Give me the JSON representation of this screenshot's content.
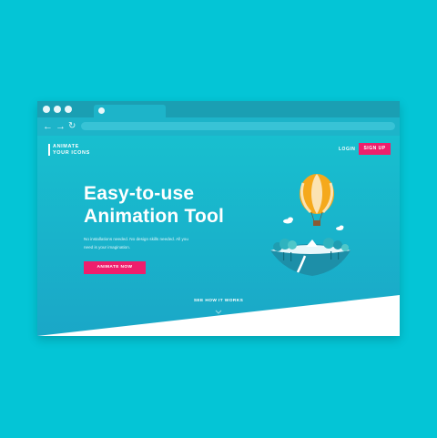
{
  "browser": {
    "nav": {
      "back": "←",
      "forward": "→",
      "reload": "↻"
    }
  },
  "site": {
    "logo_line1": "ANIMATE",
    "logo_line2": "YOUR ICONS",
    "login": "LOGIN",
    "signup": "SIGN UP",
    "headline_line1": "Easy-to-use",
    "headline_line2": "Animation Tool",
    "subtext_line1": "No installations needed. No design skills needed. All you",
    "subtext_line2": "need is your imagination.",
    "cta": "ANIMATE NOW",
    "see_how": "SEE HOW IT WORKS"
  },
  "colors": {
    "background": "#04c5d6",
    "accent": "#ef1e6c",
    "page_gradient_top": "#18bfcf",
    "page_gradient_bottom": "#1aa7c7"
  },
  "icons": {
    "chevron": "chevron-down-icon",
    "balloon": "hot-air-balloon-illustration",
    "island": "floating-island-illustration"
  }
}
